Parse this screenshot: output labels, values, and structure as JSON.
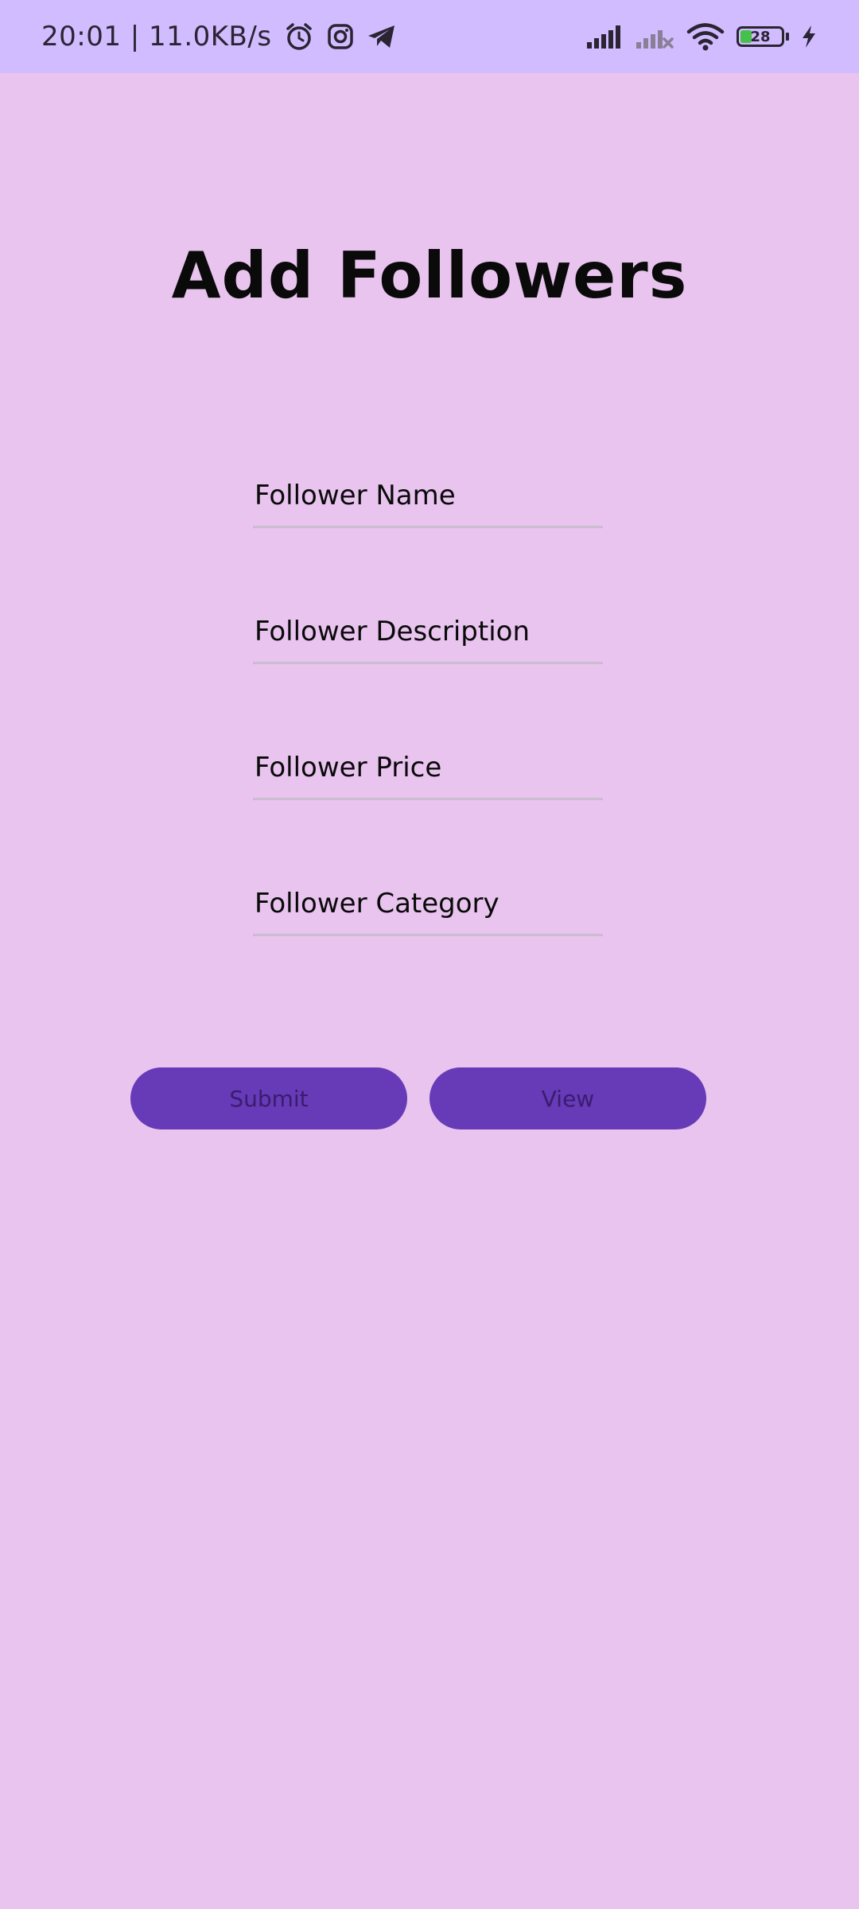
{
  "status_bar": {
    "time_speed": "20:01 | 11.0KB/s",
    "battery": "28",
    "battery_level_percent": 28,
    "icons": [
      "alarm-icon",
      "instagram-icon",
      "telegram-icon",
      "signal-icon",
      "signal-no-service-icon",
      "wifi-icon",
      "battery-icon",
      "charging-icon"
    ],
    "colors": {
      "background": "#d1bcff",
      "foreground": "#2a2433",
      "battery_fill": "#45c04a"
    }
  },
  "page": {
    "title": "Add Followers",
    "background": "#e9c4ef"
  },
  "form": {
    "fields": [
      {
        "placeholder": "Follower Name",
        "value": ""
      },
      {
        "placeholder": "Follower Description",
        "value": ""
      },
      {
        "placeholder": "Follower Price",
        "value": ""
      },
      {
        "placeholder": "Follower Category",
        "value": ""
      }
    ],
    "underline_color": "#cbbcd0"
  },
  "actions": {
    "submit_label": "Submit",
    "view_label": "View",
    "button_color": "#673ab7",
    "button_text_color": "#3a1c6e"
  }
}
